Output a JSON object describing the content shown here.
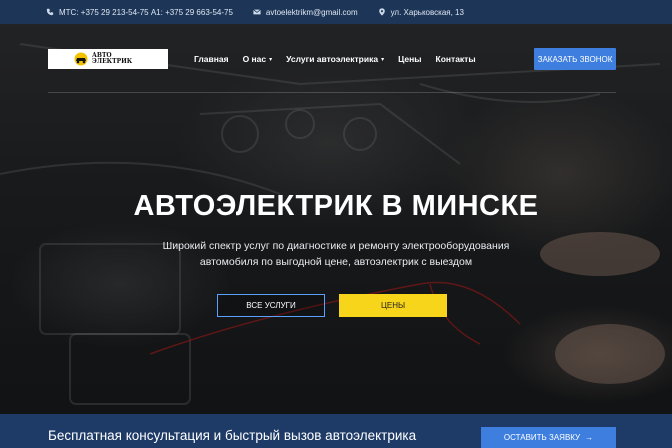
{
  "topbar": {
    "phones": "МТС: +375 29 213-54-75 A1: +375 29 663-54-75",
    "email": "avtoelektrikm@gmail.com",
    "address": "ул. Харьковская, 13"
  },
  "logo": {
    "line1": "АВТО",
    "line2": "ЭЛЕКТРИК"
  },
  "nav": {
    "home": "Главная",
    "about": "О нас",
    "services": "Услуги автоэлектрика",
    "prices": "Цены",
    "contacts": "Контакты"
  },
  "call_button": "ЗАКАЗАТЬ ЗВОНОК",
  "hero": {
    "title": "АВТОЭЛЕКТРИК В МИНСКЕ",
    "subtitle": "Широкий спектр услуг по диагностике и ремонту электрооборудования автомобиля по выгодной цене, автоэлектрик с выездом",
    "btn_services": "ВСЕ УСЛУГИ",
    "btn_prices": "ЦЕНЫ"
  },
  "cta": {
    "text": "Бесплатная консультация и быстрый вызов автоэлектрика",
    "button": "ОСТАВИТЬ ЗАЯВКУ",
    "arrow": "→"
  },
  "colors": {
    "topbar": "#1d3557",
    "accent": "#3d7ede",
    "yellow": "#f7d51a",
    "cta_bar": "#1e3b68"
  },
  "icons": [
    "phone-icon",
    "mail-icon",
    "location-icon",
    "chevron-down-icon",
    "arrow-right-icon"
  ]
}
